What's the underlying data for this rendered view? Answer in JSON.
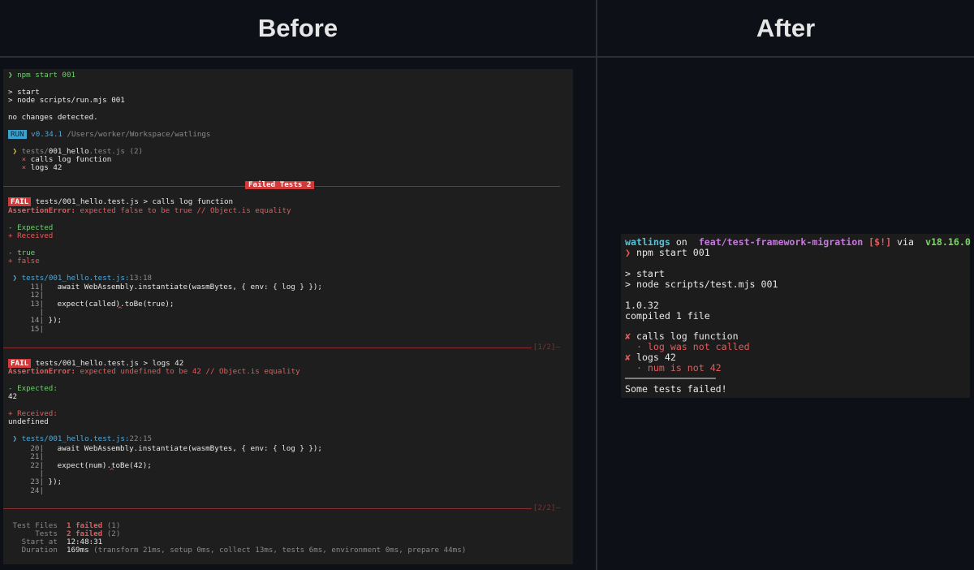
{
  "headers": {
    "before": "Before",
    "after": "After"
  },
  "before": {
    "prompt_symbol": "❯",
    "command": "npm start 001",
    "start": "> start",
    "node_cmd": "> node scripts/run.mjs 001",
    "no_changes": "no changes detected.",
    "run_badge": "RUN",
    "version": "v0.34.1",
    "path": "/Users/worker/Workspace/watlings",
    "suite_dir": "tests/",
    "suite_file": "001_hello",
    "suite_ext": ".test.js",
    "suite_count": "(2)",
    "suite_chevron": "❯",
    "cross": "×",
    "test1": "calls log function",
    "test2": "logs 42",
    "failed_tests_label": "Failed Tests 2",
    "fail_badge": "FAIL",
    "f1_title": "tests/001_hello.test.js > calls log function",
    "f1_error_name": "AssertionError:",
    "f1_error_msg": "expected false to be true // Object.is equality",
    "f1_expected": "- Expected",
    "f1_received": "+ Received",
    "f1_minus": "- true",
    "f1_plus": "+ false",
    "f1_loc_chevron": "❯",
    "f1_loc": "tests/001_hello.test.js:",
    "f1_loc_pos": "13:18",
    "f1_code": [
      {
        "num": "11|",
        "code": "   await WebAssembly.instantiate(wasmBytes, { env: { log } });"
      },
      {
        "num": "12|",
        "code": ""
      },
      {
        "num": "13|",
        "code": "   expect(called).toBe(true);"
      },
      {
        "num": "|",
        "code": "",
        "caret": "^"
      },
      {
        "num": "14|",
        "code": " });"
      },
      {
        "num": "15|",
        "code": ""
      }
    ],
    "page1": "[1/2]—",
    "f2_title": "tests/001_hello.test.js > logs 42",
    "f2_error_name": "AssertionError:",
    "f2_error_msg": "expected undefined to be 42 // Object.is equality",
    "f2_expected": "- Expected:",
    "f2_expected_val": "42",
    "f2_received": "+ Received:",
    "f2_received_val": "undefined",
    "f2_loc_chevron": "❯",
    "f2_loc": "tests/001_hello.test.js:",
    "f2_loc_pos": "22:15",
    "f2_code": [
      {
        "num": "20|",
        "code": "   await WebAssembly.instantiate(wasmBytes, { env: { log } });"
      },
      {
        "num": "21|",
        "code": ""
      },
      {
        "num": "22|",
        "code": "   expect(num).toBe(42);"
      },
      {
        "num": "|",
        "code": "",
        "caret": "^"
      },
      {
        "num": "23|",
        "code": " });"
      },
      {
        "num": "24|",
        "code": ""
      }
    ],
    "page2": "[2/2]—",
    "summary": {
      "files_label": " Test Files",
      "files_failed": "1 failed",
      "files_total": "(1)",
      "tests_label": "      Tests",
      "tests_failed": "2 failed",
      "tests_total": "(2)",
      "start_label": "   Start at",
      "start_val": "12:48:31",
      "duration_label": "   Duration",
      "duration_val": "169ms",
      "duration_detail": "(transform 21ms, setup 0ms, collect 13ms, tests 6ms, environment 0ms, prepare 44ms)"
    }
  },
  "after": {
    "dir": "watlings",
    "on": " on ",
    "branch_icon": "",
    "branch": "feat/test-framework-migration",
    "status": "[$!]",
    "via": " via ",
    "node_icon": "",
    "node_version": "v18.16.0",
    "prompt_symbol": "❯",
    "command": "npm start 001",
    "start": "> start",
    "node_cmd": "> node scripts/test.mjs 001",
    "version": "1.0.32",
    "compiled": "compiled 1 file",
    "cross": "✘",
    "test1": "calls log function",
    "test1_detail": "  · log was not called",
    "test2": "logs 42",
    "test2_detail": "  · num is not 42",
    "divider": "────────────────",
    "result": "Some tests failed!"
  }
}
